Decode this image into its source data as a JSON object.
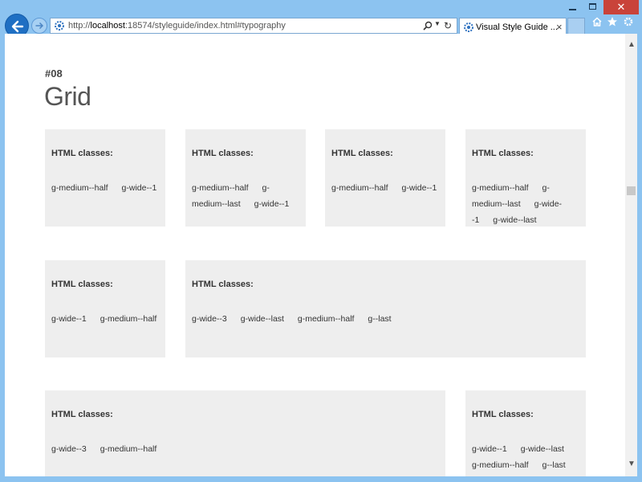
{
  "browser": {
    "url_prefix": "http://",
    "url_host": "localhost",
    "url_rest": ":18574/styleguide/index.html#typography",
    "tab_title": "Visual Style Guide ...",
    "tab_close": "×",
    "window_close": "✕"
  },
  "page": {
    "section_number": "#08",
    "section_title": "Grid",
    "cell_heading": "HTML classes:"
  },
  "rows": [
    {
      "cells": [
        {
          "heading": "HTML classes:",
          "classes": [
            "g-medium--half",
            "g-wide--1"
          ]
        },
        {
          "heading": "HTML classes:",
          "classes": [
            "g-medium--half",
            "g-medium--last",
            "g-wide--1"
          ]
        },
        {
          "heading": "HTML classes:",
          "classes": [
            "g-medium--half",
            "g-wide--1"
          ]
        },
        {
          "heading": "HTML classes:",
          "classes": [
            "g-medium--half",
            "g-medium--last",
            "g-wide--1",
            "g-wide--last"
          ]
        }
      ]
    },
    {
      "cells": [
        {
          "heading": "HTML classes:",
          "classes": [
            "g-wide--1",
            "g-medium--half"
          ]
        },
        {
          "heading": "HTML classes:",
          "classes": [
            "g-wide--3",
            "g-wide--last",
            "g-medium--half",
            "g--last"
          ]
        }
      ]
    },
    {
      "cells": [
        {
          "heading": "HTML classes:",
          "classes": [
            "g-wide--3",
            "g-medium--half"
          ]
        },
        {
          "heading": "HTML classes:",
          "classes": [
            "g-wide--1",
            "g-wide--last",
            "g-medium--half",
            "g--last"
          ]
        }
      ]
    }
  ],
  "colors": {
    "cell_background": "#eeeeee",
    "chrome": "#8cc3f0",
    "close_button": "#c9433a"
  }
}
